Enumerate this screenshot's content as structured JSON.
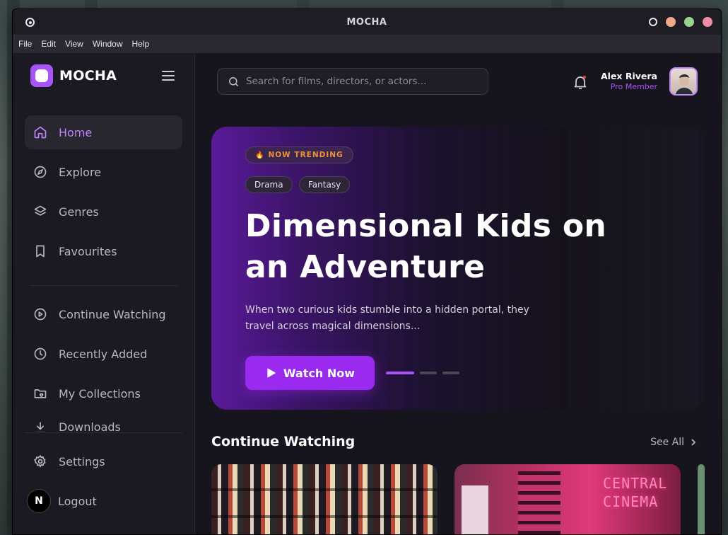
{
  "window": {
    "title": "MOCHA",
    "control_colors": [
      "#e8e6ec",
      "#f2a98a",
      "#9bd28f",
      "#ee8ea6"
    ]
  },
  "menubar": [
    "File",
    "Edit",
    "View",
    "Window",
    "Help"
  ],
  "sidebar": {
    "brand": "MOCHA",
    "primary": [
      {
        "label": "Home",
        "icon": "home-icon",
        "active": true
      },
      {
        "label": "Explore",
        "icon": "compass-icon"
      },
      {
        "label": "Genres",
        "icon": "layers-icon"
      },
      {
        "label": "Favourites",
        "icon": "bookmark-icon"
      }
    ],
    "secondary": [
      {
        "label": "Continue Watching",
        "icon": "play-circle-icon"
      },
      {
        "label": "Recently Added",
        "icon": "clock-icon"
      },
      {
        "label": "My Collections",
        "icon": "folder-heart-icon"
      },
      {
        "label": "Downloads",
        "icon": "download-icon"
      }
    ],
    "bottom": [
      {
        "label": "Settings",
        "icon": "gear-icon"
      },
      {
        "label": "Logout",
        "icon": "logout-icon",
        "avatar_letter": "N"
      }
    ]
  },
  "header": {
    "search_placeholder": "Search for films, directors, or actors...",
    "user_name": "Alex Rivera",
    "user_role": "Pro Member"
  },
  "hero": {
    "badge": "NOW TRENDING",
    "badge_emoji": "🔥",
    "tags": [
      "Drama",
      "Fantasy"
    ],
    "title": "Dimensional Kids on an Adventure",
    "description": "When two curious kids stumble into a hidden portal, they travel across magical dimensions...",
    "cta": "Watch Now",
    "slides_total": 3,
    "slide_active": 1,
    "accent": "#a855f7"
  },
  "continue_watching": {
    "title": "Continue Watching",
    "see_all": "See All",
    "cards": [
      {
        "kind": "poster-wall"
      },
      {
        "kind": "neon-sign",
        "sign_text": "CENTRAL CINEMA"
      }
    ]
  }
}
